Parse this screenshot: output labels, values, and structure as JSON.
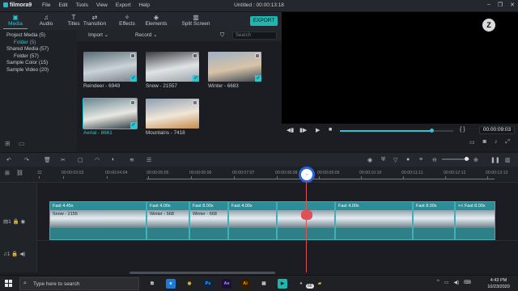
{
  "titlebar": {
    "app_name": "filmora9",
    "menu": [
      "File",
      "Edit",
      "Tools",
      "View",
      "Export",
      "Help"
    ],
    "document_title": "Untitled : 00:00:13:18",
    "window_controls": [
      "–",
      "❐",
      "✕"
    ]
  },
  "tabs": [
    {
      "label": "Media",
      "icon": "media-icon",
      "glyph": "▣",
      "active": true
    },
    {
      "label": "Audio",
      "icon": "music-note-icon",
      "glyph": "♫",
      "active": false
    },
    {
      "label": "Titles",
      "icon": "text-icon",
      "glyph": "T",
      "active": false
    },
    {
      "label": "Transition",
      "icon": "transition-icon",
      "glyph": "⇄",
      "active": false
    },
    {
      "label": "Effects",
      "icon": "effects-icon",
      "glyph": "✧",
      "active": false
    },
    {
      "label": "Elements",
      "icon": "elements-icon",
      "glyph": "◈",
      "active": false
    },
    {
      "label": "Split Screen",
      "icon": "split-screen-icon",
      "glyph": "▥",
      "active": false
    }
  ],
  "export_label": "EXPORT",
  "library": {
    "items": [
      {
        "label": "Project Media (5)",
        "sub": false,
        "active": false
      },
      {
        "label": "Folder (5)",
        "sub": true,
        "active": true
      },
      {
        "label": "Shared Media (57)",
        "sub": false,
        "active": false
      },
      {
        "label": "Folder (57)",
        "sub": true,
        "active": false
      },
      {
        "label": "Sample Color (15)",
        "sub": false,
        "active": false
      },
      {
        "label": "Sample Video (20)",
        "sub": false,
        "active": false
      }
    ]
  },
  "media_head": {
    "import_label": "Import",
    "record_label": "Record",
    "search_placeholder": "Search"
  },
  "media_items": [
    {
      "caption": "Reindeer - 6949",
      "selected": false,
      "checked": true,
      "colors": [
        "#5b6b74",
        "#c9d3d8",
        "#7b8289"
      ]
    },
    {
      "caption": "Snow - 21557",
      "selected": false,
      "checked": true,
      "colors": [
        "#3a3e42",
        "#dfe3e6",
        "#9aa3a8"
      ]
    },
    {
      "caption": "Winter - 6683",
      "selected": false,
      "checked": true,
      "colors": [
        "#9db1c4",
        "#d8c3a8",
        "#3b4652"
      ]
    },
    {
      "caption": "Aerial - 8661",
      "selected": true,
      "checked": true,
      "colors": [
        "#6a8794",
        "#e8e8e2",
        "#2c3a40"
      ]
    },
    {
      "caption": "Mountains - 7418",
      "selected": false,
      "checked": false,
      "colors": [
        "#8e9fb3",
        "#f0e6d8",
        "#c58a4a"
      ]
    }
  ],
  "player": {
    "timecode": "00:00:09:03",
    "progress": 0.81
  },
  "ruler_ticks": [
    "32",
    "00:00:03:03",
    "00:00:04:04",
    "00:00:05:05",
    "00:00:06:06",
    "00:00:07:07",
    "00:00:08:08",
    "00:00:09:09",
    "00:00:10:10",
    "00:00:11:11",
    "00:00:12:12",
    "00:00:13:13"
  ],
  "track_heads": {
    "video": "1",
    "audio": "1"
  },
  "clips": [
    {
      "label": "Fast 4.45x",
      "sub": "Snow - 2155"
    },
    {
      "label": "Fast 4.00x",
      "sub": "Winter - 668"
    },
    {
      "label": "Fast 8.00x",
      "sub": "Winter - 668"
    },
    {
      "label": "Fast 4.00x",
      "sub": ""
    },
    {
      "label": "",
      "sub": ""
    },
    {
      "label": "Fast 4.00x",
      "sub": ""
    },
    {
      "label": "Fast 8.00x",
      "sub": ""
    },
    {
      "label": "<< Fast 8.00x",
      "sub": ""
    }
  ],
  "taskbar": {
    "search_text": "Type here to search",
    "time": "4:43 PM",
    "date": "10/23/2020",
    "badge": "66",
    "apps": [
      {
        "name": "task-view-icon",
        "text": "⧉",
        "bg": "#202124",
        "fg": "#e4e7eb"
      },
      {
        "name": "edge-icon",
        "text": "e",
        "bg": "#1f7ad6",
        "fg": "#ffffff"
      },
      {
        "name": "chrome-icon",
        "text": "◉",
        "bg": "#202124",
        "fg": "#e8b83a"
      },
      {
        "name": "photoshop-icon",
        "text": "Ps",
        "bg": "#0f2440",
        "fg": "#31a8ff"
      },
      {
        "name": "after-effects-icon",
        "text": "Ae",
        "bg": "#1d0f3a",
        "fg": "#9999ff"
      },
      {
        "name": "illustrator-icon",
        "text": "Ai",
        "bg": "#331c00",
        "fg": "#ff9a00"
      },
      {
        "name": "notepad-icon",
        "text": "▤",
        "bg": "#202124",
        "fg": "#e4e7eb"
      },
      {
        "name": "filmora-icon",
        "text": "▶",
        "bg": "#1fb5b0",
        "fg": "#0e1b1c"
      },
      {
        "name": "app-icon",
        "text": "●",
        "bg": "#202124",
        "fg": "#aeb3bb"
      },
      {
        "name": "explorer-icon",
        "text": "▰",
        "bg": "#202124",
        "fg": "#e8b83a"
      }
    ]
  }
}
